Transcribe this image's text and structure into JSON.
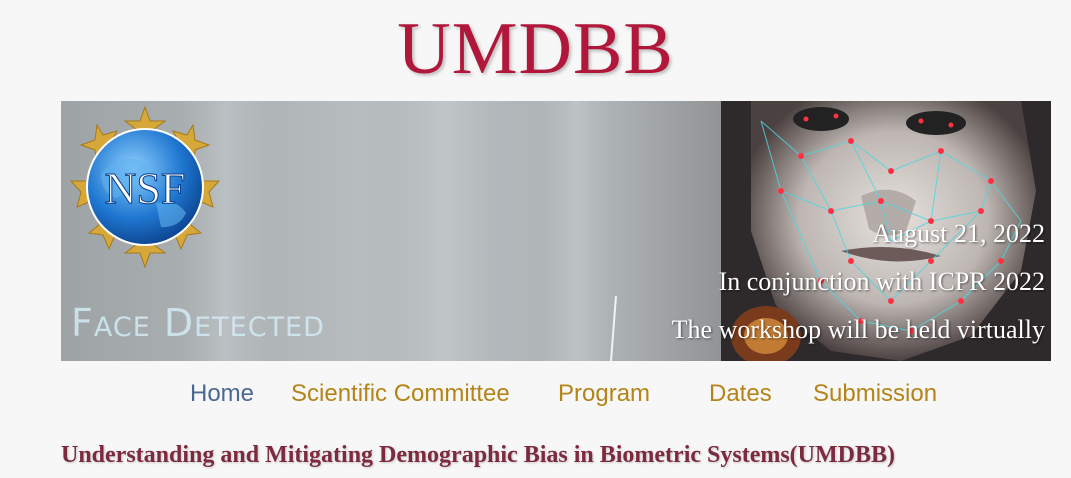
{
  "header": {
    "title": "UMDBB"
  },
  "banner": {
    "logo_text": "NSF",
    "overlay_label": "Face Detected",
    "date_text": "August 21, 2022",
    "conjunction_text": "In conjunction with ICPR 2022",
    "virtual_text": "The workshop will be held virtually"
  },
  "nav": {
    "items": [
      {
        "label": "Home",
        "active": true
      },
      {
        "label": "Scientific Committee",
        "active": false
      },
      {
        "label": "Program",
        "active": false
      },
      {
        "label": "Dates",
        "active": false
      },
      {
        "label": "Submission",
        "active": false
      }
    ]
  },
  "main": {
    "subtitle": "Understanding and Mitigating Demographic Bias in Biometric Systems(UMDBB)"
  },
  "colors": {
    "title": "#b0173a",
    "nav_active": "#4a6894",
    "nav_inactive": "#b48418",
    "subtitle": "#7c2a3e"
  },
  "icons": {
    "logo": "nsf-globe-logo",
    "face_mesh": "face-landmark-mesh"
  }
}
